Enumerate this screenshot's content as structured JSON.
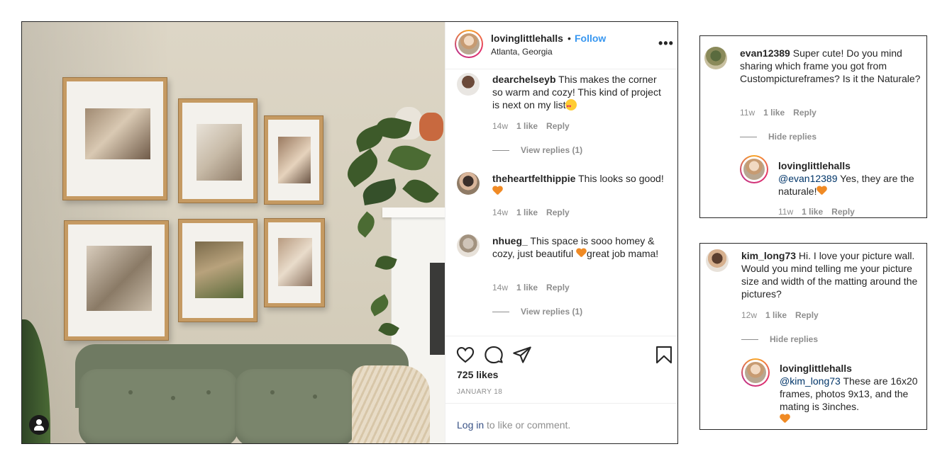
{
  "post": {
    "owner": "lovinglittlehalls",
    "separator": "•",
    "follow_label": "Follow",
    "location": "Atlanta, Georgia",
    "more_label": "•••",
    "likes": "725 likes",
    "date": "JANUARY 18",
    "login_link": "Log in",
    "login_rest": " to like or comment.",
    "comments": [
      {
        "user": "dearchelseyb",
        "text": " This makes the corner so warm and cozy! This kind of project is next on my list",
        "emoji": "heart-eyes-emoji",
        "age": "14w",
        "likes": "1 like",
        "reply": "Reply",
        "view_replies": "View replies (1)"
      },
      {
        "user": "theheartfelthippie",
        "text": " This looks so good! ",
        "emoji": "orange-heart-emoji",
        "age": "14w",
        "likes": "1 like",
        "reply": "Reply"
      },
      {
        "user": "nhueg_",
        "text_before": " This space is sooo homey & cozy, just beautiful ",
        "text_after": "great job mama!",
        "emoji": "orange-heart-emoji",
        "age": "14w",
        "likes": "1 like",
        "reply": "Reply",
        "view_replies": "View replies (1)"
      }
    ]
  },
  "panel1": {
    "user": "evan12389",
    "text": " Super cute! Do you mind sharing which frame you got from Custompictureframes? Is it the Naturale?",
    "age": "11w",
    "likes": "1 like",
    "reply": "Reply",
    "hide_replies": "Hide replies",
    "reply_user": "lovinglittlehalls",
    "reply_mention": "@evan12389",
    "reply_text": " Yes, they are the naturale!",
    "reply_age": "11w",
    "reply_likes": "1 like",
    "reply_reply": "Reply"
  },
  "panel2": {
    "user": "kim_long73",
    "text": " Hi. I love your picture wall. Would you mind telling me your picture size and width of the matting around the pictures?",
    "age": "12w",
    "likes": "1 like",
    "reply": "Reply",
    "hide_replies": "Hide replies",
    "reply_user": "lovinglittlehalls",
    "reply_mention": "@kim_long73",
    "reply_text": " These are 16x20 frames, photos 9x13, and the mating is 3inches.",
    "emoji": "orange-heart-emoji"
  },
  "icons": {
    "like": "heart-outline-icon",
    "comment": "comment-bubble-icon",
    "share": "paper-plane-icon",
    "save": "bookmark-icon",
    "tag": "user-tag-icon",
    "more": "more-options-icon"
  },
  "colors": {
    "follow": "#3897f0",
    "muted": "#8e8e8e",
    "text": "#262626",
    "login_link": "#385185",
    "mention": "#003569"
  }
}
